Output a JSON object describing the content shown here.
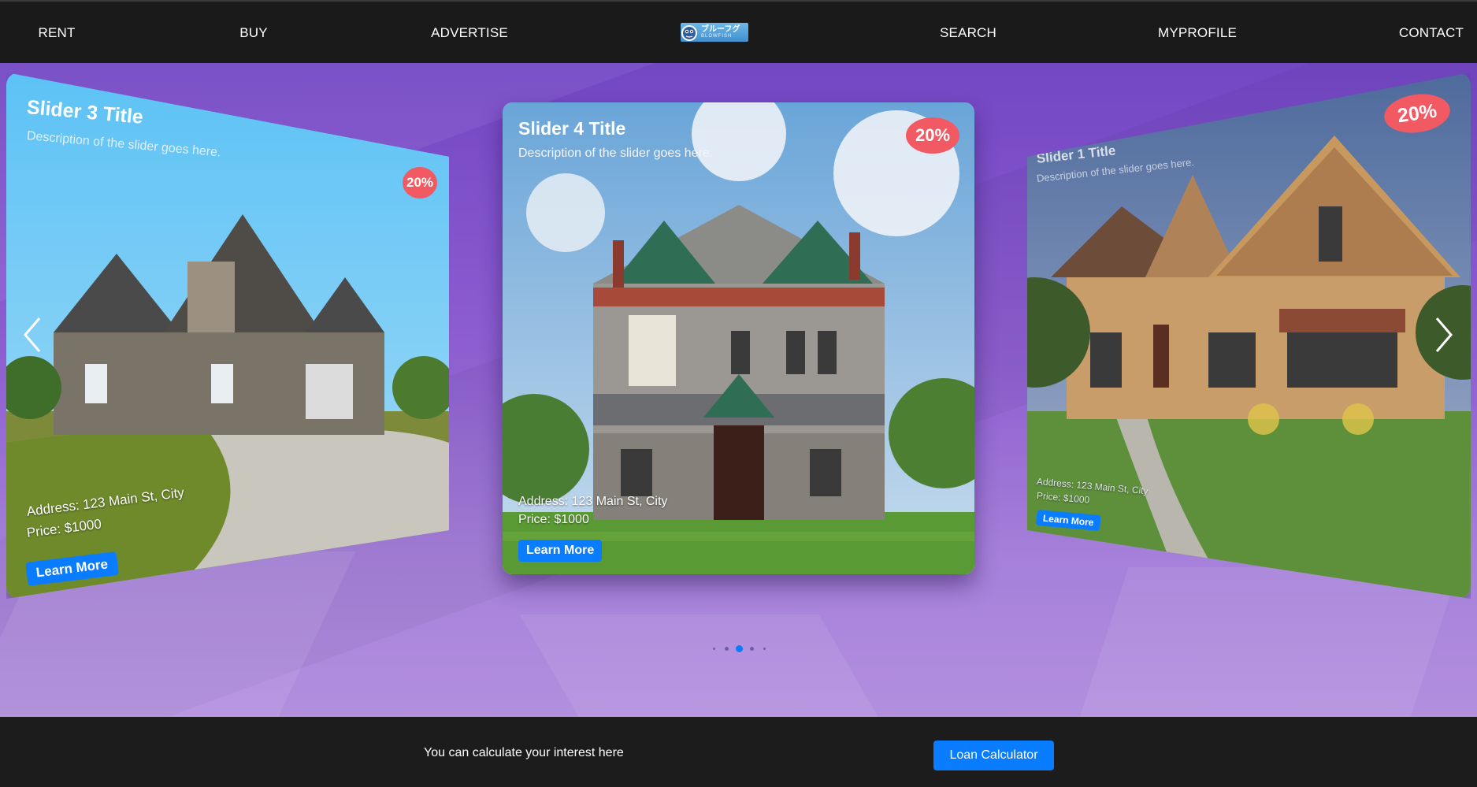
{
  "nav": {
    "rent": "RENT",
    "buy": "BUY",
    "advertise": "ADVERTISE",
    "search": "SEARCH",
    "myprofile": "MYPROFILE",
    "contact": "CONTACT",
    "logo_text_jp": "ブルーフグ",
    "logo_text_en": "BLOWFISH"
  },
  "slides": {
    "left": {
      "title": "Slider 3 Title",
      "description": "Description of the slider goes here.",
      "badge": "20%",
      "address": "Address: 123 Main St, City",
      "price": "Price: $1000",
      "button": "Learn More"
    },
    "center": {
      "title": "Slider 4 Title",
      "description": "Description of the slider goes here.",
      "badge": "20%",
      "address": "Address: 123 Main St, City",
      "price": "Price: $1000",
      "button": "Learn More"
    },
    "right": {
      "title": "Slider 1 Title",
      "description": "Description of the slider goes here.",
      "badge": "20%",
      "address": "Address: 123 Main St, City",
      "price": "Price: $1000",
      "button": "Learn More"
    }
  },
  "pagination": {
    "total": 5,
    "active_index": 2
  },
  "footer": {
    "text": "You can calculate your interest here",
    "button": "Loan Calculator"
  },
  "colors": {
    "accent": "#0a7cff",
    "badge": "#f25a63",
    "nav_bg": "#1a1a1a",
    "stage_top": "#7346c4",
    "stage_bottom": "#b38fdf"
  },
  "icons": {
    "prev": "chevron-left-icon",
    "next": "chevron-right-icon",
    "logo": "blowfish-logo-icon"
  }
}
